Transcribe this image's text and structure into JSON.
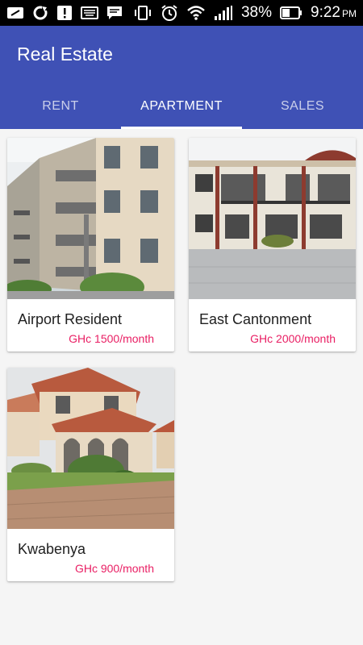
{
  "status_bar": {
    "battery_percent": "38%",
    "time": "9:22",
    "time_suffix": "PM",
    "left_icons": [
      "link-icon",
      "sync-icon",
      "alert-icon",
      "keyboard-icon",
      "message-icon"
    ],
    "right_icons": [
      "vibrate-icon",
      "alarm-icon",
      "wifi-icon",
      "signal-icon",
      "battery-icon"
    ]
  },
  "app_bar": {
    "title": "Real Estate",
    "color": "#3f51b5"
  },
  "tabs": [
    {
      "label": "RENT",
      "active": false
    },
    {
      "label": "APARTMENT",
      "active": true
    },
    {
      "label": "SALES",
      "active": false
    }
  ],
  "listings": [
    {
      "name": "Airport Resident",
      "price": "GHc 1500/month"
    },
    {
      "name": "East Cantonment",
      "price": "GHc 2000/month"
    },
    {
      "name": "Kwabenya",
      "price": "GHc 900/month"
    }
  ],
  "accent_color": "#e91e63"
}
